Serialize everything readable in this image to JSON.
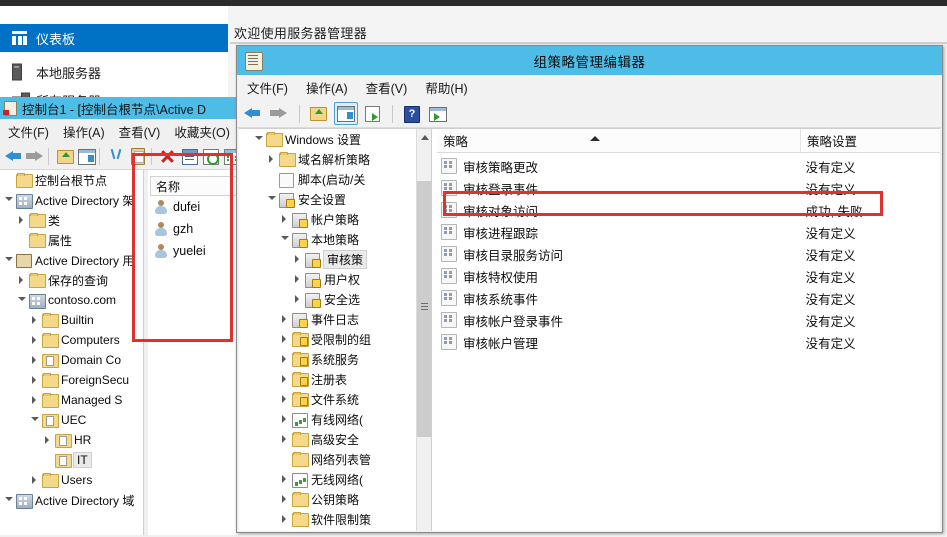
{
  "server_manager": {
    "welcome_title": "欢迎使用服务器管理器",
    "nav_items": [
      {
        "label": "仪表板",
        "icon": "dashboard-icon",
        "selected": true
      },
      {
        "label": "本地服务器",
        "icon": "server-icon",
        "selected": false
      },
      {
        "label": "所有服务器",
        "icon": "all-servers-icon",
        "selected": false
      }
    ]
  },
  "mmc_window": {
    "title": "控制台1 - [控制台根节点\\Active D",
    "menu": [
      "文件(F)",
      "操作(A)",
      "查看(V)",
      "收藏夹(O)"
    ],
    "toolbar_icons": [
      "back-icon",
      "forward-icon",
      "up-folder-icon",
      "show-hide-panes-icon",
      "cut-icon",
      "paste-icon",
      "delete-icon",
      "properties-icon",
      "refresh-icon",
      "list-icon"
    ],
    "tree": [
      {
        "label": "控制台根节点",
        "indent": 0,
        "twisty": "none",
        "icon": "folder-icon"
      },
      {
        "label": "Active Directory 架",
        "indent": 0,
        "twisty": "open",
        "icon": "ad-schema-icon"
      },
      {
        "label": "类",
        "indent": 1,
        "twisty": "closed",
        "icon": "folder-icon"
      },
      {
        "label": "属性",
        "indent": 1,
        "twisty": "none",
        "icon": "folder-icon"
      },
      {
        "label": "Active Directory 用",
        "indent": 0,
        "twisty": "open",
        "icon": "ad-users-icon"
      },
      {
        "label": "保存的查询",
        "indent": 1,
        "twisty": "closed",
        "icon": "folder-icon"
      },
      {
        "label": "contoso.com",
        "indent": 1,
        "twisty": "open",
        "icon": "domain-icon"
      },
      {
        "label": "Builtin",
        "indent": 2,
        "twisty": "closed",
        "icon": "folder-icon"
      },
      {
        "label": "Computers",
        "indent": 2,
        "twisty": "closed",
        "icon": "folder-icon"
      },
      {
        "label": "Domain Co",
        "indent": 2,
        "twisty": "closed",
        "icon": "ou-icon"
      },
      {
        "label": "ForeignSecu",
        "indent": 2,
        "twisty": "closed",
        "icon": "folder-icon"
      },
      {
        "label": "Managed S",
        "indent": 2,
        "twisty": "closed",
        "icon": "folder-icon"
      },
      {
        "label": "UEC",
        "indent": 2,
        "twisty": "open",
        "icon": "ou-icon"
      },
      {
        "label": "HR",
        "indent": 3,
        "twisty": "closed",
        "icon": "ou-icon"
      },
      {
        "label": "IT",
        "indent": 3,
        "twisty": "none",
        "icon": "ou-icon",
        "selected": true
      },
      {
        "label": "Users",
        "indent": 2,
        "twisty": "closed",
        "icon": "folder-icon"
      },
      {
        "label": "Active Directory 域",
        "indent": 0,
        "twisty": "open",
        "icon": "ad-sites-icon"
      }
    ],
    "list": {
      "column_header": "名称",
      "rows": [
        {
          "name": "dufei",
          "icon": "user-icon"
        },
        {
          "name": "gzh",
          "icon": "user-icon"
        },
        {
          "name": "yuelei",
          "icon": "user-icon"
        }
      ]
    }
  },
  "gpo_window": {
    "title": "组策略管理编辑器",
    "title_icon": "gpo-scroll-icon",
    "menu": [
      "文件(F)",
      "操作(A)",
      "查看(V)",
      "帮助(H)"
    ],
    "toolbar_icons": [
      "back-icon",
      "forward-icon",
      "up-folder-icon",
      "show-hide-panes-icon",
      "export-list-icon",
      "help-icon",
      "show-contents-icon"
    ],
    "tree": [
      {
        "label": "Windows 设置",
        "indent": 1,
        "twisty": "open",
        "icon": "folder-icon"
      },
      {
        "label": "域名解析策略",
        "indent": 2,
        "twisty": "closed",
        "icon": "folder-icon"
      },
      {
        "label": "脚本(启动/关",
        "indent": 2,
        "twisty": "none",
        "icon": "script-icon"
      },
      {
        "label": "安全设置",
        "indent": 2,
        "twisty": "open",
        "icon": "security-settings-icon"
      },
      {
        "label": "帐户策略",
        "indent": 3,
        "twisty": "closed",
        "icon": "policy-icon"
      },
      {
        "label": "本地策略",
        "indent": 3,
        "twisty": "open",
        "icon": "policy-icon"
      },
      {
        "label": "审核策",
        "indent": 4,
        "twisty": "closed",
        "icon": "policy-icon",
        "selected": true
      },
      {
        "label": "用户权",
        "indent": 4,
        "twisty": "closed",
        "icon": "policy-icon"
      },
      {
        "label": "安全选",
        "indent": 4,
        "twisty": "closed",
        "icon": "policy-icon"
      },
      {
        "label": "事件日志",
        "indent": 3,
        "twisty": "closed",
        "icon": "policy-icon"
      },
      {
        "label": "受限制的组",
        "indent": 3,
        "twisty": "closed",
        "icon": "folder-lock-icon"
      },
      {
        "label": "系统服务",
        "indent": 3,
        "twisty": "closed",
        "icon": "folder-lock-icon"
      },
      {
        "label": "注册表",
        "indent": 3,
        "twisty": "closed",
        "icon": "folder-lock-icon"
      },
      {
        "label": "文件系统",
        "indent": 3,
        "twisty": "closed",
        "icon": "folder-lock-icon"
      },
      {
        "label": "有线网络(",
        "indent": 3,
        "twisty": "closed",
        "icon": "wired-network-icon"
      },
      {
        "label": "高级安全",
        "indent": 3,
        "twisty": "closed",
        "icon": "folder-icon"
      },
      {
        "label": "网络列表管",
        "indent": 3,
        "twisty": "none",
        "icon": "folder-icon"
      },
      {
        "label": "无线网络(",
        "indent": 3,
        "twisty": "closed",
        "icon": "wireless-network-icon"
      },
      {
        "label": "公钥策略",
        "indent": 3,
        "twisty": "closed",
        "icon": "folder-icon"
      },
      {
        "label": "软件限制策",
        "indent": 3,
        "twisty": "closed",
        "icon": "folder-icon"
      }
    ],
    "list": {
      "columns": [
        "策略",
        "策略设置"
      ],
      "sort": "ascending",
      "rows": [
        {
          "policy": "审核策略更改",
          "setting": "没有定义",
          "highlighted": false
        },
        {
          "policy": "审核登录事件",
          "setting": "没有定义",
          "highlighted": false
        },
        {
          "policy": "审核对象访问",
          "setting": "成功, 失败",
          "highlighted": true
        },
        {
          "policy": "审核进程跟踪",
          "setting": "没有定义",
          "highlighted": false
        },
        {
          "policy": "审核目录服务访问",
          "setting": "没有定义",
          "highlighted": false
        },
        {
          "policy": "审核特权使用",
          "setting": "没有定义",
          "highlighted": false
        },
        {
          "policy": "审核系统事件",
          "setting": "没有定义",
          "highlighted": false
        },
        {
          "policy": "审核帐户登录事件",
          "setting": "没有定义",
          "highlighted": false
        },
        {
          "policy": "审核帐户管理",
          "setting": "没有定义",
          "highlighted": false
        }
      ]
    }
  },
  "annotations": {
    "colors": {
      "highlight": "#e03030",
      "titlebar": "#4dbde8",
      "accent": "#0072c6"
    },
    "boxes": [
      {
        "name": "user-list-highlight"
      },
      {
        "name": "audit-object-access-highlight"
      }
    ]
  }
}
